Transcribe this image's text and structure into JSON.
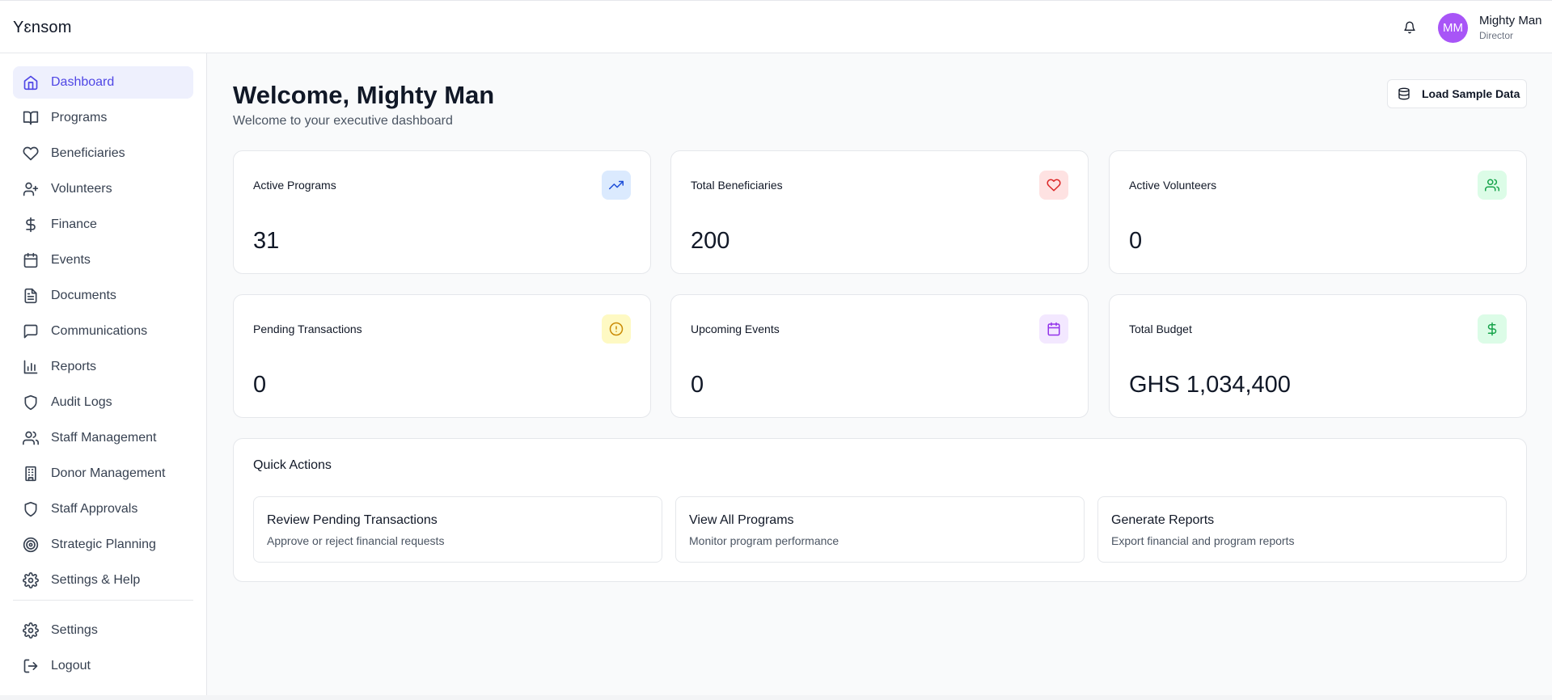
{
  "header": {
    "brand": "Yɛnsom",
    "user": {
      "initials": "MM",
      "name": "Mighty Man",
      "role": "Director"
    }
  },
  "sidebar": {
    "items": [
      {
        "label": "Dashboard",
        "icon": "home-icon",
        "active": true
      },
      {
        "label": "Programs",
        "icon": "book-open-icon"
      },
      {
        "label": "Beneficiaries",
        "icon": "heart-icon"
      },
      {
        "label": "Volunteers",
        "icon": "user-plus-icon"
      },
      {
        "label": "Finance",
        "icon": "dollar-sign-icon"
      },
      {
        "label": "Events",
        "icon": "calendar-icon"
      },
      {
        "label": "Documents",
        "icon": "file-text-icon"
      },
      {
        "label": "Communications",
        "icon": "message-square-icon"
      },
      {
        "label": "Reports",
        "icon": "bar-chart-icon"
      },
      {
        "label": "Audit Logs",
        "icon": "shield-icon"
      },
      {
        "label": "Staff Management",
        "icon": "users-icon"
      },
      {
        "label": "Donor Management",
        "icon": "building-icon"
      },
      {
        "label": "Staff Approvals",
        "icon": "shield-icon"
      },
      {
        "label": "Strategic Planning",
        "icon": "target-icon"
      },
      {
        "label": "Settings & Help",
        "icon": "gear-icon"
      }
    ],
    "bottom": [
      {
        "label": "Settings",
        "icon": "gear-icon"
      },
      {
        "label": "Logout",
        "icon": "log-out-icon"
      }
    ]
  },
  "main": {
    "title": "Welcome, Mighty Man",
    "subtitle": "Welcome to your executive dashboard",
    "load_sample_label": "Load Sample Data",
    "stats": [
      {
        "label": "Active Programs",
        "value": "31",
        "icon": "trending-up-icon",
        "icon_color": "#1d4ed8",
        "icon_bg": "#dbeafe"
      },
      {
        "label": "Total Beneficiaries",
        "value": "200",
        "icon": "heart-icon",
        "icon_color": "#dc2626",
        "icon_bg": "#fee2e2"
      },
      {
        "label": "Active Volunteers",
        "value": "0",
        "icon": "users-icon",
        "icon_color": "#16a34a",
        "icon_bg": "#dcfce7"
      },
      {
        "label": "Pending Transactions",
        "value": "0",
        "icon": "alert-circle-icon",
        "icon_color": "#ca8a04",
        "icon_bg": "#fef9c3"
      },
      {
        "label": "Upcoming Events",
        "value": "0",
        "icon": "calendar-icon",
        "icon_color": "#9333ea",
        "icon_bg": "#f3e8ff"
      },
      {
        "label": "Total Budget",
        "value": "GHS 1,034,400",
        "icon": "dollar-sign-icon",
        "icon_color": "#16a34a",
        "icon_bg": "#dcfce7"
      }
    ],
    "quick_actions": {
      "title": "Quick Actions",
      "items": [
        {
          "title": "Review Pending Transactions",
          "description": "Approve or reject financial requests"
        },
        {
          "title": "View All Programs",
          "description": "Monitor program performance"
        },
        {
          "title": "Generate Reports",
          "description": "Export financial and program reports"
        }
      ]
    }
  }
}
